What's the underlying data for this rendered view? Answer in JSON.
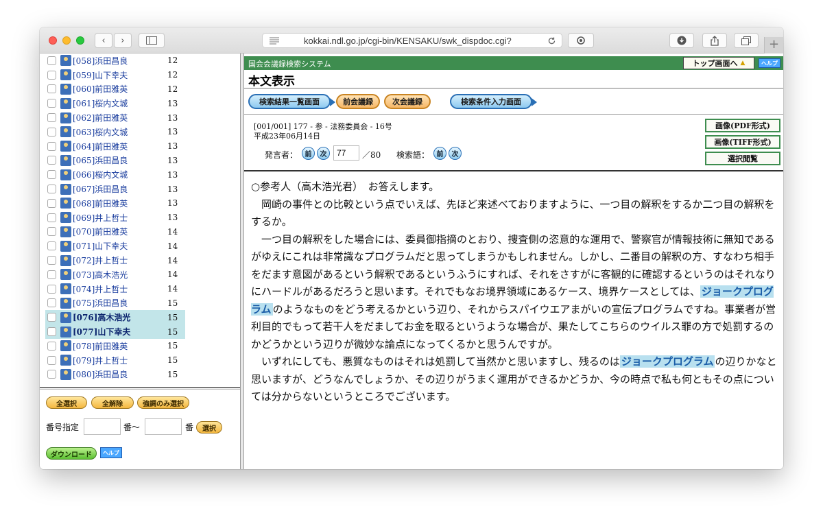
{
  "browser": {
    "url": "kokkai.ndl.go.jp/cgi-bin/KENSAKU/swk_dispdoc.cgi?",
    "new_tab_label": "+"
  },
  "speakers": [
    {
      "label": "[058]浜田昌良",
      "count": "12",
      "highlighted": false
    },
    {
      "label": "[059]山下幸夫",
      "count": "12",
      "highlighted": false
    },
    {
      "label": "[060]前田雅英",
      "count": "12",
      "highlighted": false
    },
    {
      "label": "[061]桜内文城",
      "count": "13",
      "highlighted": false
    },
    {
      "label": "[062]前田雅英",
      "count": "13",
      "highlighted": false
    },
    {
      "label": "[063]桜内文城",
      "count": "13",
      "highlighted": false
    },
    {
      "label": "[064]前田雅英",
      "count": "13",
      "highlighted": false
    },
    {
      "label": "[065]浜田昌良",
      "count": "13",
      "highlighted": false
    },
    {
      "label": "[066]桜内文城",
      "count": "13",
      "highlighted": false
    },
    {
      "label": "[067]浜田昌良",
      "count": "13",
      "highlighted": false
    },
    {
      "label": "[068]前田雅英",
      "count": "13",
      "highlighted": false
    },
    {
      "label": "[069]井上哲士",
      "count": "13",
      "highlighted": false
    },
    {
      "label": "[070]前田雅英",
      "count": "14",
      "highlighted": false
    },
    {
      "label": "[071]山下幸夫",
      "count": "14",
      "highlighted": false
    },
    {
      "label": "[072]井上哲士",
      "count": "14",
      "highlighted": false
    },
    {
      "label": "[073]高木浩光",
      "count": "14",
      "highlighted": false
    },
    {
      "label": "[074]井上哲士",
      "count": "14",
      "highlighted": false
    },
    {
      "label": "[075]浜田昌良",
      "count": "15",
      "highlighted": false
    },
    {
      "label": "[076]高木浩光",
      "count": "15",
      "highlighted": true
    },
    {
      "label": "[077]山下幸夫",
      "count": "15",
      "highlighted": true
    },
    {
      "label": "[078]前田雅英",
      "count": "15",
      "highlighted": false
    },
    {
      "label": "[079]井上哲士",
      "count": "15",
      "highlighted": false
    },
    {
      "label": "[080]浜田昌良",
      "count": "15",
      "highlighted": false
    }
  ],
  "selection": {
    "select_all": "全選択",
    "deselect_all": "全解除",
    "select_emphasis": "強調のみ選択",
    "number_label": "番号指定",
    "from_suffix": "番〜",
    "to_suffix": "番",
    "select_button": "選択",
    "download": "ダウンロード",
    "help": "ヘルプ"
  },
  "header": {
    "system_title": "国会会議録検索システム",
    "top_button": "トップ画面へ",
    "help": "ヘルプ",
    "page_title": "本文表示"
  },
  "nav": {
    "results_list": "検索結果一覧画面",
    "prev_record": "前会議録",
    "next_record": "次会議録",
    "search_conditions": "検索条件入力画面"
  },
  "doc": {
    "meta_line1": "[001/001] 177 - 参 - 法務委員会 - 16号",
    "meta_line2": "平成23年06月14日",
    "speaker_label": "発言者：",
    "prev": "前",
    "next": "次",
    "speaker_number": "77",
    "total": "／80",
    "keyword_label": "検索語：",
    "pdf_button": "画像(PDF形式)",
    "tiff_button": "画像(TIFF形式)",
    "select_view_button": "選択閲覧"
  },
  "speech": {
    "speaker_line": "○参考人（高木浩光君）　お答えします。",
    "p1": "岡崎の事件との比較という点でいえば、先ほど来述べておりますように、一つ目の解釈をするか二つ目の解釈をするか。",
    "p2_before": "一つ目の解釈をした場合には、委員御指摘のとおり、捜査側の恣意的な運用で、警察官が情報技術に無知であるがゆえにこれは非常識なプログラムだと思ってしまうかもしれません。しかし、二番目の解釈の方、すなわち相手をだます意図があるという解釈であるというふうにすれば、それをさすがに客観的に確認するというのはそれなりにハードルがあるだろうと思います。それでもなお境界領域にあるケース、境界ケースとしては、",
    "keyword": "ジョークプログラム",
    "p2_after": "のようなものをどう考えるかという辺り、それからスパイウエアまがいの宣伝プログラムですね。事業者が営利目的でもって若干人をだましてお金を取るというような場合が、果たしてこちらのウイルス罪の方で処罰するのかどうかという辺りが微妙な論点になってくるかと思うんですが。",
    "p3_before": "いずれにしても、悪質なものはそれは処罰して当然かと思いますし、残るのは",
    "p3_after": "の辺りかなと思いますが、どうなんでしょうか、その辺りがうまく運用ができるかどうか、今の時点で私も何ともその点については分からないというところでございます。"
  },
  "colors": {
    "system_bar": "#3e8d4f",
    "highlight_row": "#c2e5e9",
    "keyword_bg": "#b8e0ef",
    "link": "#1a3d9e"
  }
}
